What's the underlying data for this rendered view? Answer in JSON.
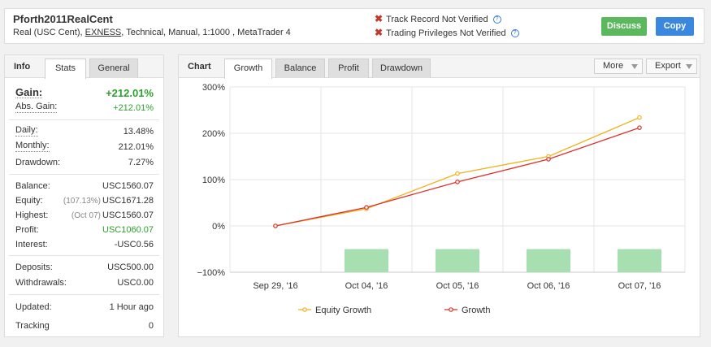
{
  "account": {
    "name": "Pforth2011RealCent",
    "type": "Real (USC Cent),",
    "broker": "EXNESS",
    "details": ", Technical, Manual, 1:1000 , MetaTrader 4"
  },
  "verification": {
    "track_record": "Track Record Not Verified",
    "trading_privileges": "Trading Privileges Not Verified",
    "help_glyph": "?"
  },
  "buttons": {
    "discuss": "Discuss",
    "copy": "Copy"
  },
  "info_panel": {
    "title": "Info",
    "tabs": [
      "Stats",
      "General"
    ],
    "stats": {
      "gain": {
        "label": "Gain:",
        "value": "+212.01%"
      },
      "abs_gain": {
        "label": "Abs. Gain:",
        "value": "+212.01%"
      },
      "daily": {
        "label": "Daily:",
        "value": "13.48%"
      },
      "monthly": {
        "label": "Monthly:",
        "value": "212.01%"
      },
      "drawdown": {
        "label": "Drawdown:",
        "value": "7.27%"
      },
      "balance": {
        "label": "Balance:",
        "value": "USC1560.07"
      },
      "equity": {
        "label": "Equity:",
        "note": "(107.13%)",
        "value": "USC1671.28"
      },
      "highest": {
        "label": "Highest:",
        "note": "(Oct 07)",
        "value": "USC1560.07"
      },
      "profit": {
        "label": "Profit:",
        "value": "USC1060.07"
      },
      "interest": {
        "label": "Interest:",
        "value": "-USC0.56"
      },
      "deposits": {
        "label": "Deposits:",
        "value": "USC500.00"
      },
      "withdrawals": {
        "label": "Withdrawals:",
        "value": "USC0.00"
      },
      "updated": {
        "label": "Updated:",
        "value": "1 Hour ago"
      },
      "tracking": {
        "label": "Tracking",
        "value": "0"
      }
    }
  },
  "chart_panel": {
    "title": "Chart",
    "tabs": [
      "Growth",
      "Balance",
      "Profit",
      "Drawdown"
    ],
    "active_tab": "Growth",
    "dropdowns": {
      "more": "More",
      "export": "Export"
    }
  },
  "colors": {
    "equity": "#f0b21e",
    "growth": "#d9322b",
    "bars": "#a8dfb0",
    "accent_green": "#5cb85c",
    "accent_blue": "#3a87e0"
  },
  "chart_data": {
    "type": "line",
    "categories": [
      "Sep 29, '16",
      "Oct 04, '16",
      "Oct 05, '16",
      "Oct 06, '16",
      "Oct 07, '16"
    ],
    "yticks": [
      "300%",
      "200%",
      "100%",
      "0%",
      "−100%"
    ],
    "ylim": [
      -100,
      300
    ],
    "series": [
      {
        "name": "Equity Growth",
        "values": [
          0,
          37,
          113,
          150,
          234
        ]
      },
      {
        "name": "Growth",
        "values": [
          0,
          40,
          95,
          144,
          212
        ]
      }
    ],
    "bars": {
      "categories": [
        "Oct 04, '16",
        "Oct 05, '16",
        "Oct 06, '16",
        "Oct 07, '16"
      ],
      "values": [
        -50,
        -50,
        -50,
        -50
      ]
    },
    "grid": true,
    "legend": "bottom"
  }
}
